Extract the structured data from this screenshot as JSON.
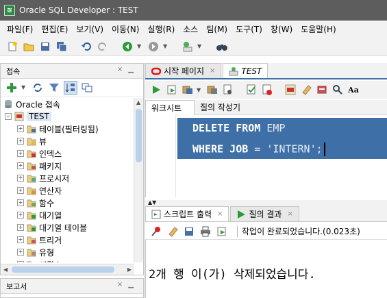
{
  "window": {
    "title": "Oracle SQL Developer : TEST"
  },
  "menu": [
    "파일(F)",
    "편집(E)",
    "보기(V)",
    "이동(N)",
    "실행(R)",
    "소스",
    "팀(M)",
    "도구(T)",
    "창(W)",
    "도움말(H)"
  ],
  "connections_panel": {
    "title": "접속",
    "tree": {
      "root": "Oracle 접속",
      "connection": "TEST",
      "items": [
        "테이블(필터링됨)",
        "뷰",
        "인덱스",
        "패키지",
        "프로시저",
        "연산자",
        "함수",
        "대기열",
        "대기열 테이블",
        "트리거",
        "유형",
        "시퀀스"
      ]
    }
  },
  "reports_panel": {
    "title": "보고서"
  },
  "editor_tabs": [
    {
      "label": "시작 페이지",
      "active": false
    },
    {
      "label": "TEST",
      "active": true
    }
  ],
  "editor_subtabs": [
    "워크시트",
    "질의 작성기"
  ],
  "sql": {
    "line1_kw": "DELETE FROM",
    "line1_rest": " EMP",
    "line2_kw": "WHERE JOB",
    "line2_rest": " = 'INTERN';"
  },
  "output_tabs": [
    {
      "label": "스크립트 출력",
      "active": true
    },
    {
      "label": "질의 결과",
      "active": false
    }
  ],
  "output": {
    "status": "작업이 완료되었습니다.(0.023초)",
    "message": "2개 행 이(가) 삭제되었습니다."
  },
  "colors": {
    "selection": "#3e6fa6",
    "titlebar": "#5d5d5d"
  }
}
